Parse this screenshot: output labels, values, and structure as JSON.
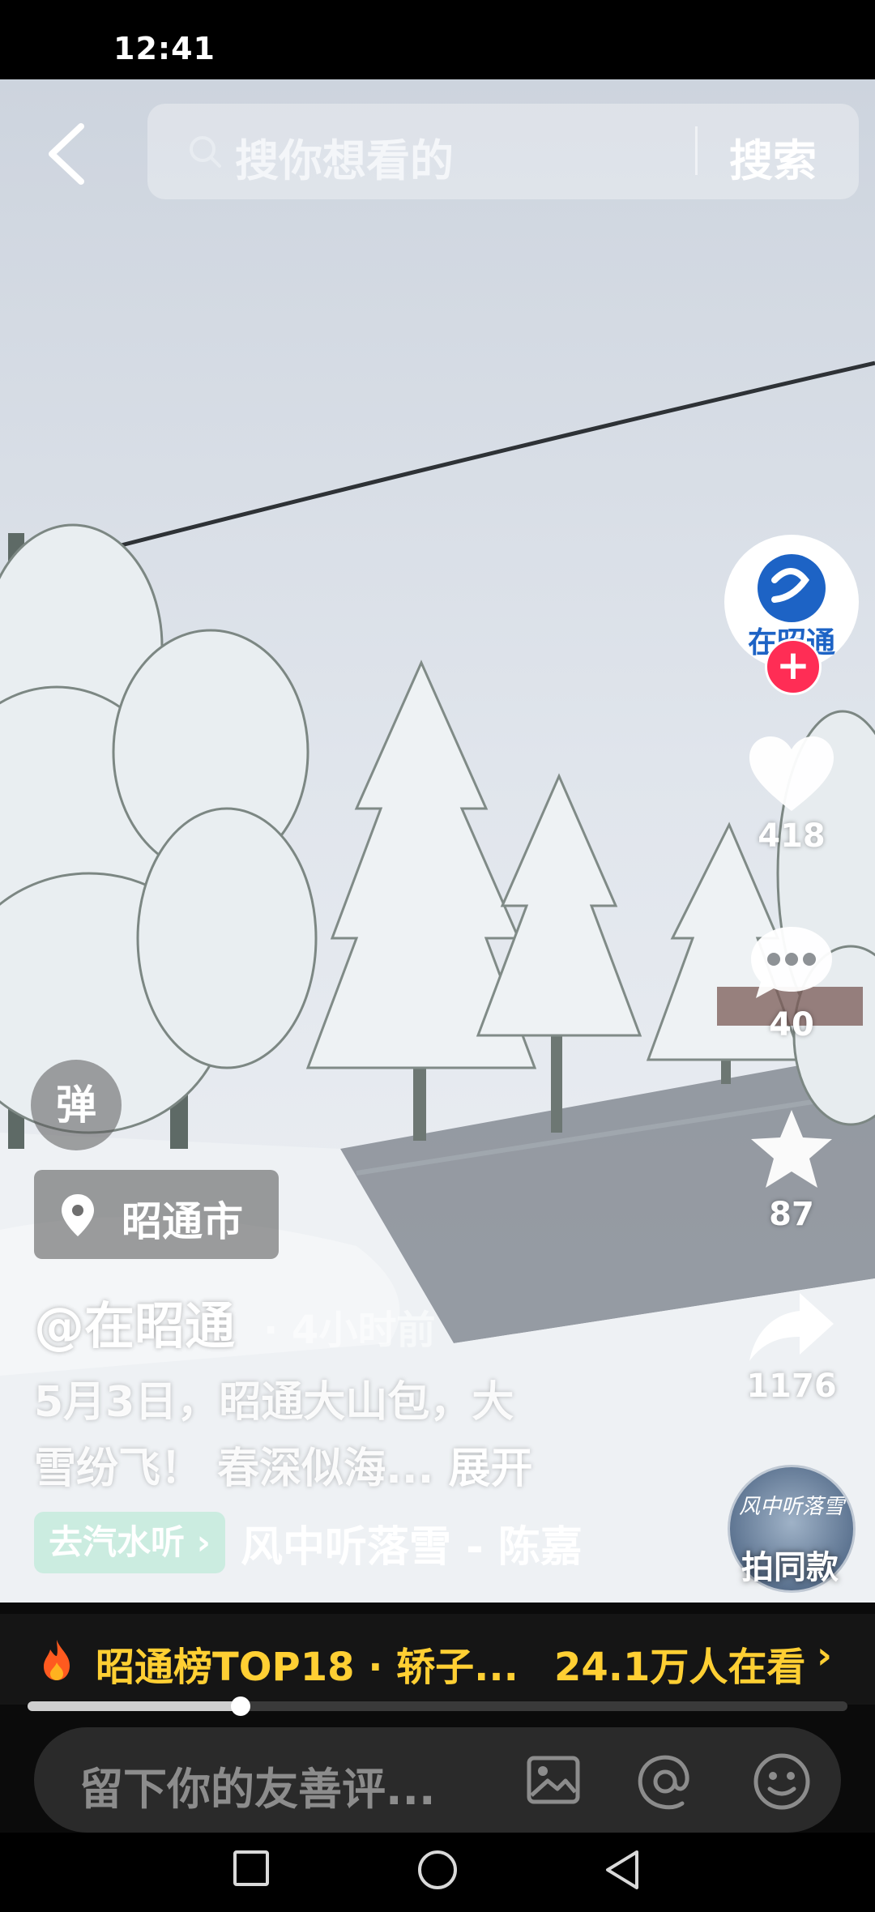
{
  "status_bar": {
    "time": "12:41"
  },
  "search": {
    "placeholder": "搜你想看的",
    "button": "搜索"
  },
  "author": {
    "avatar_text": "在昭通",
    "name": "@在昭通",
    "time_ago": "· 4小时前",
    "follow": "+"
  },
  "actions": {
    "likes": "418",
    "comments": "40",
    "favorites": "87",
    "shares": "1176"
  },
  "danmu": "弹",
  "location": "昭通市",
  "description": {
    "line1": "5月3日，昭通大山包，大",
    "line2": "雪纷飞！ 春深似海... ",
    "expand": "展开"
  },
  "music": {
    "chip": "去汽水听 ›",
    "title": "风中听落雪 - 陈嘉",
    "disc_text": "风中听落雪",
    "same_style": "拍同款"
  },
  "ranking": {
    "text": "昭通榜TOP18 · 轿子...",
    "viewers": "24.1万人在看",
    "chevron": "›"
  },
  "progress": {
    "fraction": 0.26
  },
  "comment": {
    "placeholder": "留下你的友善评..."
  },
  "colors": {
    "accent_yellow": "#ffcf33",
    "follow_red": "#ff2d55",
    "brand_blue": "#1d63c5"
  }
}
